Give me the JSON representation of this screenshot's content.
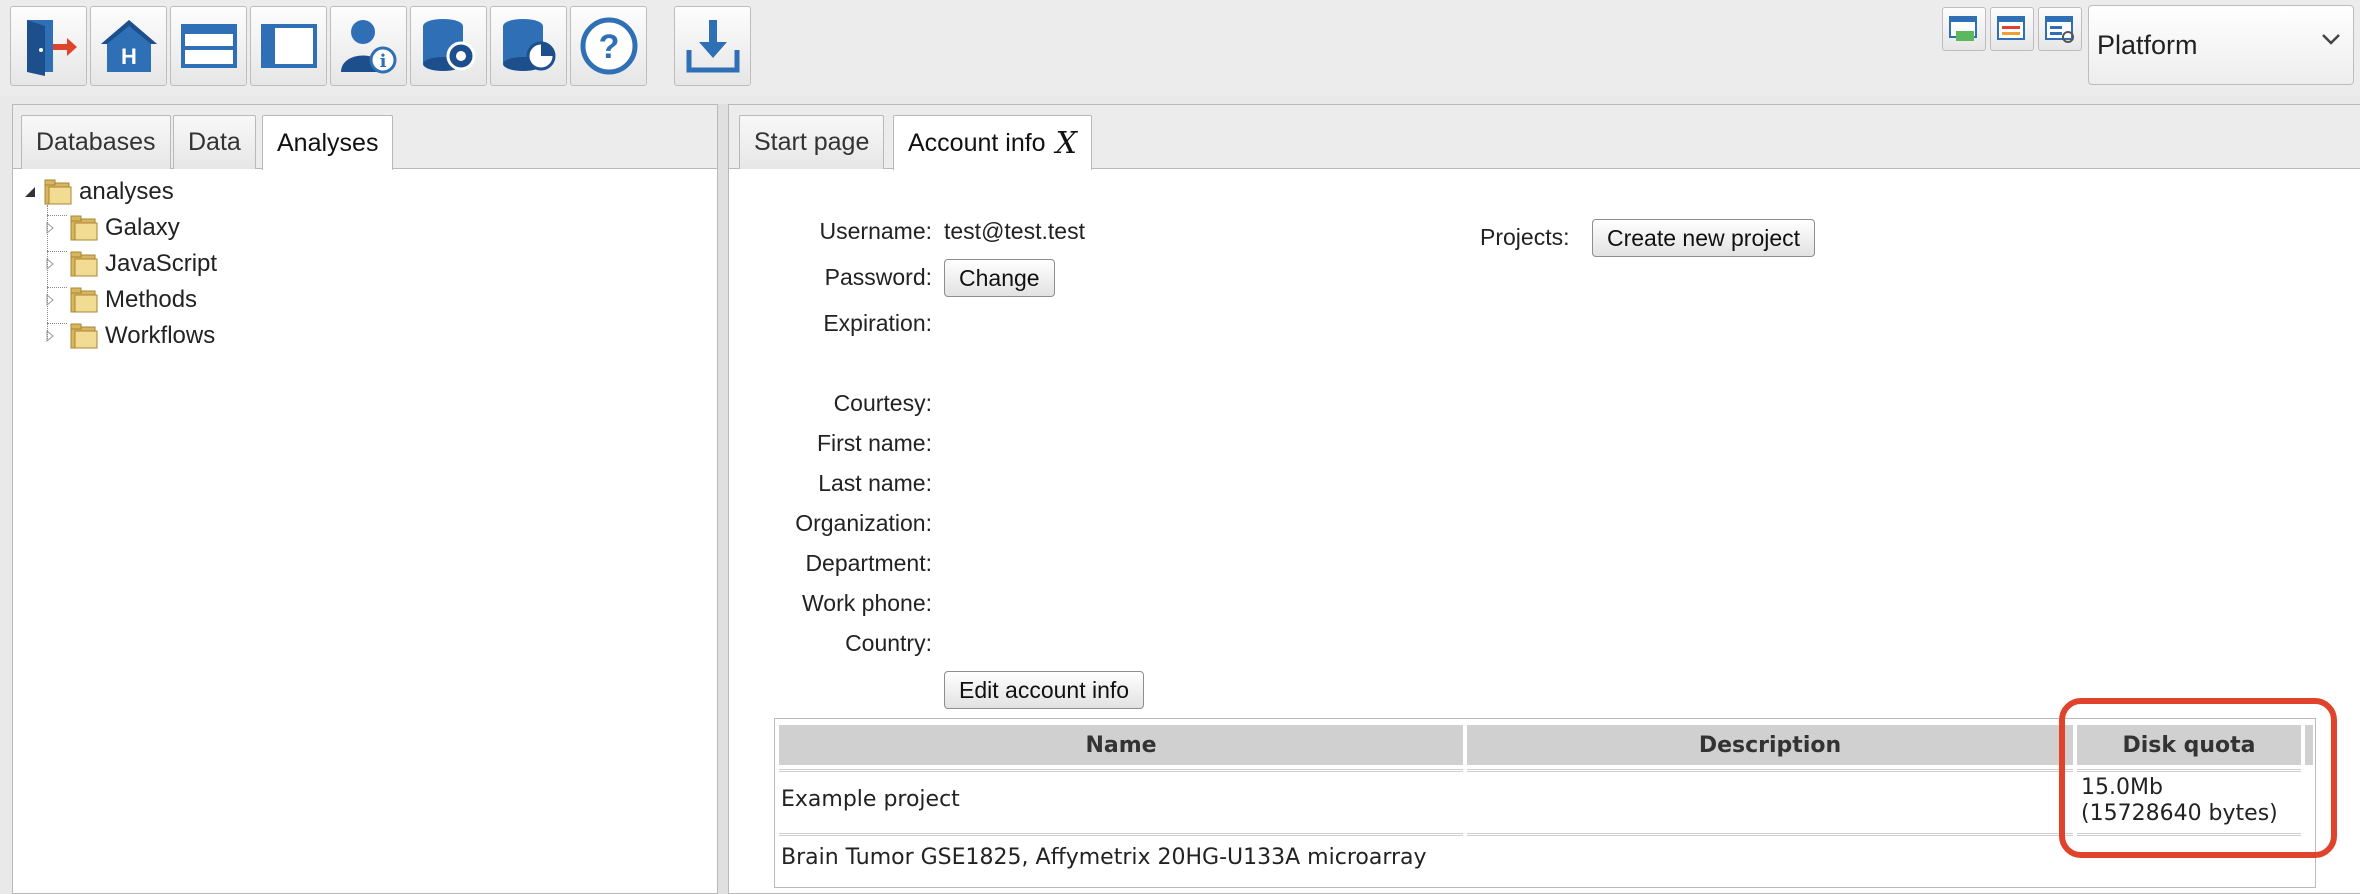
{
  "toolbar": {
    "buttons": [
      {
        "icon": "logout-door-icon"
      },
      {
        "icon": "home-icon"
      },
      {
        "icon": "horizontal-layout-icon"
      },
      {
        "icon": "vertical-layout-icon"
      },
      {
        "icon": "user-info-icon"
      },
      {
        "icon": "database-settings-icon"
      },
      {
        "icon": "database-chart-icon"
      },
      {
        "icon": "help-icon"
      },
      {
        "icon": "download-icon"
      }
    ],
    "small_buttons": [
      {
        "icon": "window-sync-icon"
      },
      {
        "icon": "window-list-icon"
      },
      {
        "icon": "window-refresh-icon"
      }
    ],
    "perspective_select": {
      "value": "Platform"
    }
  },
  "left_panel": {
    "tabs": [
      {
        "label": "Databases",
        "active": false
      },
      {
        "label": "Data",
        "active": false
      },
      {
        "label": "Analyses",
        "active": true
      }
    ],
    "tree": {
      "root": "analyses",
      "children": [
        "Galaxy",
        "JavaScript",
        "Methods",
        "Workflows"
      ]
    }
  },
  "right_panel": {
    "tabs": [
      {
        "label": "Start page",
        "active": false
      },
      {
        "label": "Account info",
        "active": true,
        "close": "X"
      }
    ],
    "account": {
      "username_label": "Username:",
      "username_value": "test@test.test",
      "password_label": "Password:",
      "change_button": "Change",
      "expiration_label": "Expiration:",
      "courtesy_label": "Courtesy:",
      "first_name_label": "First name:",
      "last_name_label": "Last name:",
      "organization_label": "Organization:",
      "department_label": "Department:",
      "work_phone_label": "Work phone:",
      "country_label": "Country:",
      "edit_button": "Edit account info",
      "projects_label": "Projects:",
      "create_project_button": "Create new project"
    },
    "projects_table": {
      "columns": [
        "Name",
        "Description",
        "Disk quota"
      ],
      "rows": [
        {
          "name": "Example project",
          "description": "",
          "quota_line1": "15.0Mb",
          "quota_line2": "(15728640 bytes)"
        },
        {
          "name": "Brain Tumor GSE1825, Affymetrix 20HG-U133A microarray",
          "description": "",
          "quota_line1": "",
          "quota_line2": ""
        }
      ]
    },
    "highlight_color": "#e0432b"
  }
}
